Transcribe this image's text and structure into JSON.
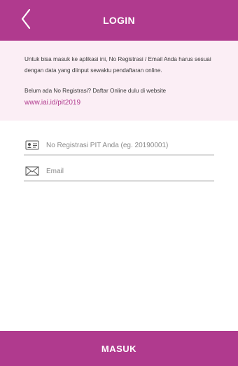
{
  "header": {
    "title": "LOGIN",
    "back_icon": "chevron-left-icon"
  },
  "info": {
    "line1": "Untuk bisa masuk ke aplikasi ini, No Registrasi / Email Anda harus sesuai dengan data yang diinput sewaktu pendaftaran online.",
    "line2": "Belum ada No Registrasi? Daftar Online dulu di website",
    "link": "www.iai.id/pit2019"
  },
  "form": {
    "registration": {
      "placeholder": "No Registrasi PIT Anda (eg. 20190001)",
      "value": "",
      "icon": "id-card-icon"
    },
    "email": {
      "placeholder": "Email",
      "value": "",
      "icon": "envelope-icon"
    }
  },
  "footer": {
    "submit_label": "MASUK"
  },
  "colors": {
    "brand": "#b03a8e",
    "info_bg": "#fbeef5",
    "link": "#b03a8e"
  }
}
